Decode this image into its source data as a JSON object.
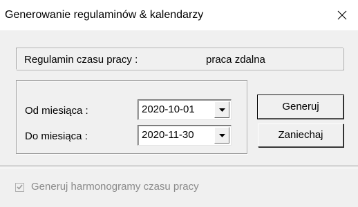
{
  "window": {
    "title": "Generowanie regulaminów & kalendarzy",
    "close_icon": "close-icon"
  },
  "regulation": {
    "label": "Regulamin czasu pracy :",
    "value": "praca zdalna"
  },
  "period": {
    "from_label": "Od miesiąca :",
    "from_value": "2020-10-01",
    "to_label": "Do miesiąca :",
    "to_value": "2020-11-30",
    "dropdown_icon": "triangle-down-icon"
  },
  "buttons": {
    "generate": "Generuj",
    "cancel": "Zaniechaj"
  },
  "options": {
    "generate_schedules_label": "Generuj harmonogramy czasu pracy",
    "generate_schedules_checked": true,
    "generate_schedules_enabled": false
  },
  "colors": {
    "titlebar_bg": "#ffffff",
    "dialog_bg": "#f0f0f0",
    "disabled_text": "#8a8a8a"
  }
}
